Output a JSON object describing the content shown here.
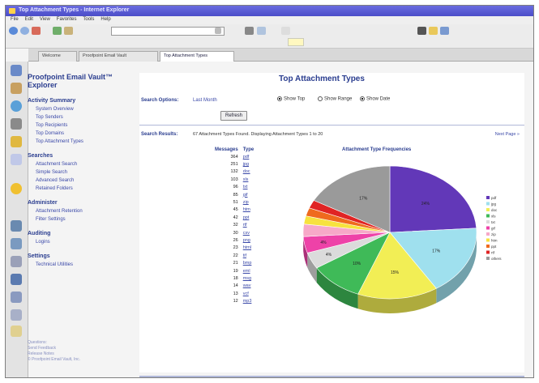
{
  "window": {
    "title": "Top Attachment Types - Internet Explorer",
    "menu": [
      "File",
      "Edit",
      "View",
      "Favorites",
      "Tools",
      "Help"
    ]
  },
  "tabs": [
    {
      "label": "Welcome"
    },
    {
      "label": "Proofpoint Email Vault"
    },
    {
      "label": "Top Attachment Types"
    }
  ],
  "sidebar": {
    "heading": "Proofpoint Email Vault™ Explorer",
    "sections": [
      {
        "title": "Activity Summary",
        "items": [
          "System Overview",
          "Top Senders",
          "Top Recipients",
          "Top Domains",
          "Top Attachment Types"
        ]
      },
      {
        "title": "Searches",
        "items": [
          "Attachment Search",
          "Simple Search",
          "Advanced Search",
          "Retained Folders"
        ]
      },
      {
        "title": "Administer",
        "items": [
          "Attachment Retention",
          "Filter Settings"
        ]
      },
      {
        "title": "Auditing",
        "items": [
          "Logins"
        ]
      },
      {
        "title": "Settings",
        "items": [
          "Technical Utilities"
        ]
      }
    ],
    "footer": [
      "Questions:",
      "Send Feedback",
      "Release Notes",
      "© Proofpoint Email Vault, Inc."
    ]
  },
  "main": {
    "title": "Top Attachment Types",
    "search_options_label": "Search Options:",
    "search_options_link": "Last Month",
    "radios": [
      {
        "label": "Show Top",
        "selected": true
      },
      {
        "label": "Show Range",
        "selected": false
      },
      {
        "label": "Show Date",
        "selected": true
      }
    ],
    "refresh_label": "Refresh",
    "results_label": "Search Results:",
    "results_text": "67 Attachment Types Found. Displaying Attachment Types 1 to 20",
    "results_right": "Next Page »",
    "table_headers": [
      "Messages",
      "Type"
    ],
    "chart_title": "Attachment Type Frequencies"
  },
  "table_rows": [
    {
      "count": "364",
      "type": "pdf"
    },
    {
      "count": "251",
      "type": "jpg"
    },
    {
      "count": "132",
      "type": "doc"
    },
    {
      "count": "103",
      "type": "xls"
    },
    {
      "count": "96",
      "type": "txt"
    },
    {
      "count": "85",
      "type": "gif"
    },
    {
      "count": "51",
      "type": "zip"
    },
    {
      "count": "45",
      "type": "htm"
    },
    {
      "count": "42",
      "type": "ppt"
    },
    {
      "count": "32",
      "type": "rtf"
    },
    {
      "count": "30",
      "type": "csv"
    },
    {
      "count": "26",
      "type": "png"
    },
    {
      "count": "23",
      "type": "html"
    },
    {
      "count": "22",
      "type": "tif"
    },
    {
      "count": "21",
      "type": "bmp"
    },
    {
      "count": "19",
      "type": "eml"
    },
    {
      "count": "18",
      "type": "msg"
    },
    {
      "count": "14",
      "type": "wav"
    },
    {
      "count": "13",
      "type": "vcf"
    },
    {
      "count": "12",
      "type": "mp3"
    }
  ],
  "chart_data": {
    "type": "pie",
    "title": "Attachment Type Frequencies",
    "slices": [
      {
        "label": "pdf",
        "value": 24,
        "color": "#6238b8"
      },
      {
        "label": "jpg",
        "value": 17,
        "color": "#9fe0ee"
      },
      {
        "label": "doc",
        "value": 15,
        "color": "#f2ee55"
      },
      {
        "label": "xls",
        "value": 10,
        "color": "#3fba58"
      },
      {
        "label": "txt",
        "value": 4,
        "color": "#dbdbdb"
      },
      {
        "label": "gif",
        "value": 4,
        "color": "#ee42a8"
      },
      {
        "label": "zip",
        "value": 3,
        "color": "#f7a8c8"
      },
      {
        "label": "htm",
        "value": 2,
        "color": "#f7e23e"
      },
      {
        "label": "ppt",
        "value": 2,
        "color": "#ef6a1e"
      },
      {
        "label": "rtf",
        "value": 2,
        "color": "#e02424"
      },
      {
        "label": "others",
        "value": 17,
        "color": "#9a9a9a"
      }
    ],
    "labels_shown": [
      "24%",
      "17%",
      "15%",
      "10%",
      "4%",
      "4%",
      "17%"
    ],
    "legend_position": "right"
  }
}
